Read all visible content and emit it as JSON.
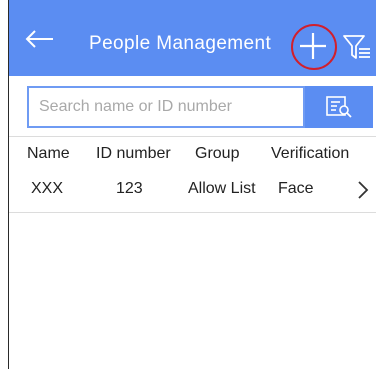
{
  "header": {
    "title": "People Management",
    "back_icon": "arrow-left-icon",
    "add_icon": "plus-icon",
    "filter_icon": "filter-icon",
    "highlight_color": "#d11f2c",
    "bg_color": "#5b8df2"
  },
  "search": {
    "placeholder": "Search name or ID number",
    "button_icon": "search-list-icon"
  },
  "table": {
    "headers": [
      "Name",
      "ID number",
      "Group",
      "Verification"
    ],
    "rows": [
      {
        "name": "XXX",
        "id": "123",
        "group": "Allow List",
        "verification": "Face",
        "action_icon": "chevron-right-icon"
      }
    ]
  }
}
